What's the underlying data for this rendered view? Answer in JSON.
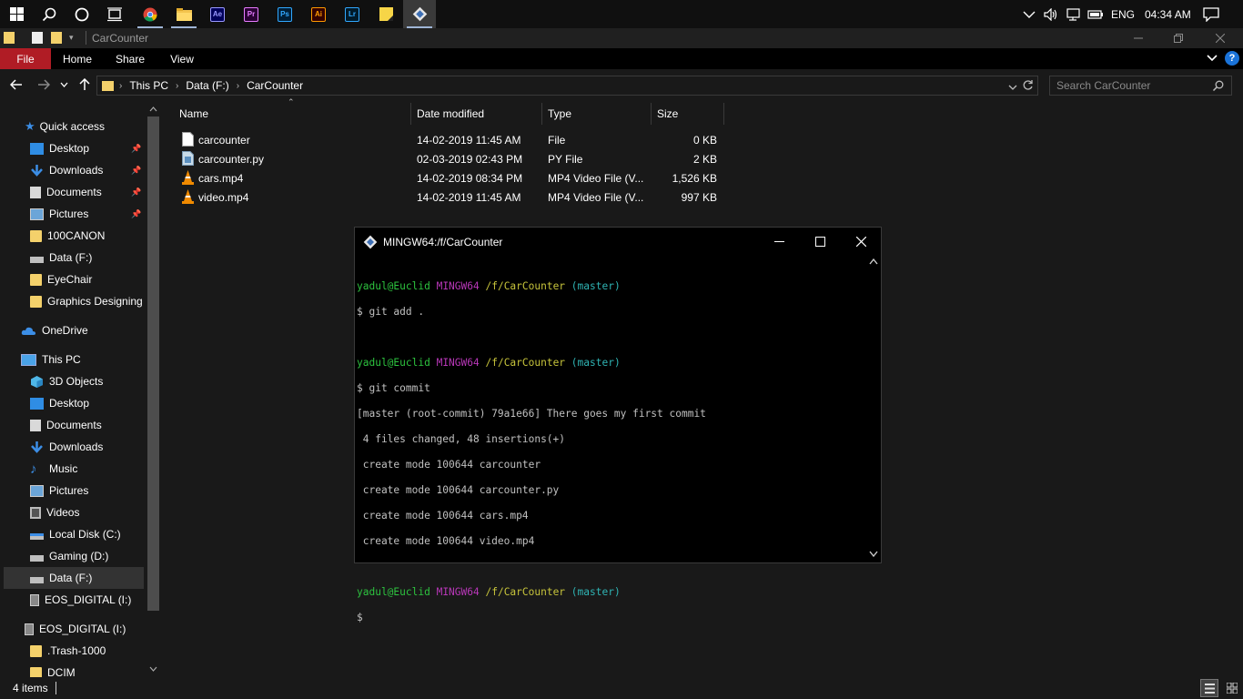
{
  "taskbar": {
    "apps": [
      {
        "name": "chrome-app",
        "label": ""
      },
      {
        "name": "file-explorer-app",
        "label": ""
      },
      {
        "name": "after-effects-app",
        "label": "Ae",
        "color": "#9999ff",
        "bg": "#00005b"
      },
      {
        "name": "premiere-app",
        "label": "Pr",
        "color": "#e77cff",
        "bg": "#2a0034"
      },
      {
        "name": "photoshop-app",
        "label": "Ps",
        "color": "#31a8ff",
        "bg": "#001e36"
      },
      {
        "name": "illustrator-app",
        "label": "Ai",
        "color": "#ff9a00",
        "bg": "#330000"
      },
      {
        "name": "lightroom-app",
        "label": "Lr",
        "color": "#31a8ff",
        "bg": "#001a29"
      },
      {
        "name": "sticky-notes-app",
        "label": ""
      },
      {
        "name": "git-bash-app",
        "label": ""
      }
    ],
    "language": "ENG",
    "time": "04:34 AM"
  },
  "explorer": {
    "window_title": "CarCounter",
    "ribbon_tabs": {
      "file": "File",
      "home": "Home",
      "share": "Share",
      "view": "View"
    },
    "breadcrumb": {
      "this_pc": "This PC",
      "drive": "Data (F:)",
      "folder": "CarCounter"
    },
    "search": {
      "placeholder": "Search CarCounter"
    },
    "nav": {
      "quick_access": "Quick access",
      "qa_desktop": "Desktop",
      "qa_downloads": "Downloads",
      "qa_documents": "Documents",
      "qa_pictures": "Pictures",
      "qa_100canon": "100CANON",
      "qa_data": "Data (F:)",
      "qa_eyechair": "EyeChair",
      "qa_graphics": "Graphics Designing",
      "onedrive": "OneDrive",
      "this_pc": "This PC",
      "pc_3d": "3D Objects",
      "pc_desktop": "Desktop",
      "pc_documents": "Documents",
      "pc_downloads": "Downloads",
      "pc_music": "Music",
      "pc_pictures": "Pictures",
      "pc_videos": "Videos",
      "pc_local_c": "Local Disk (C:)",
      "pc_gaming_d": "Gaming (D:)",
      "pc_data_f": "Data (F:)",
      "pc_eos_i": "EOS_DIGITAL (I:)",
      "eos_root": "EOS_DIGITAL (I:)",
      "trash": ".Trash-1000",
      "dcim": "DCIM"
    },
    "columns": {
      "name": "Name",
      "date": "Date modified",
      "type": "Type",
      "size": "Size"
    },
    "files": [
      {
        "name": "carcounter",
        "date": "14-02-2019 11:45 AM",
        "type": "File",
        "size": "0 KB"
      },
      {
        "name": "carcounter.py",
        "date": "02-03-2019 02:43 PM",
        "type": "PY File",
        "size": "2 KB"
      },
      {
        "name": "cars.mp4",
        "date": "14-02-2019 08:34 PM",
        "type": "MP4 Video File (V...",
        "size": "1,526 KB"
      },
      {
        "name": "video.mp4",
        "date": "14-02-2019 11:45 AM",
        "type": "MP4 Video File (V...",
        "size": "997 KB"
      }
    ],
    "status": "4 items"
  },
  "terminal": {
    "title": "MINGW64:/f/CarCounter",
    "prompt": {
      "user": "yadul@Euclid",
      "env": "MINGW64",
      "path": "/f/CarCounter",
      "branch": "(master)"
    },
    "cmd1": "$ git add .",
    "cmd2": "$ git commit",
    "out1": "[master (root-commit) 79a1e66] There goes my first commit",
    "out2": " 4 files changed, 48 insertions(+)",
    "out3": " create mode 100644 carcounter",
    "out4": " create mode 100644 carcounter.py",
    "out5": " create mode 100644 cars.mp4",
    "out6": " create mode 100644 video.mp4",
    "cursor": "$"
  }
}
